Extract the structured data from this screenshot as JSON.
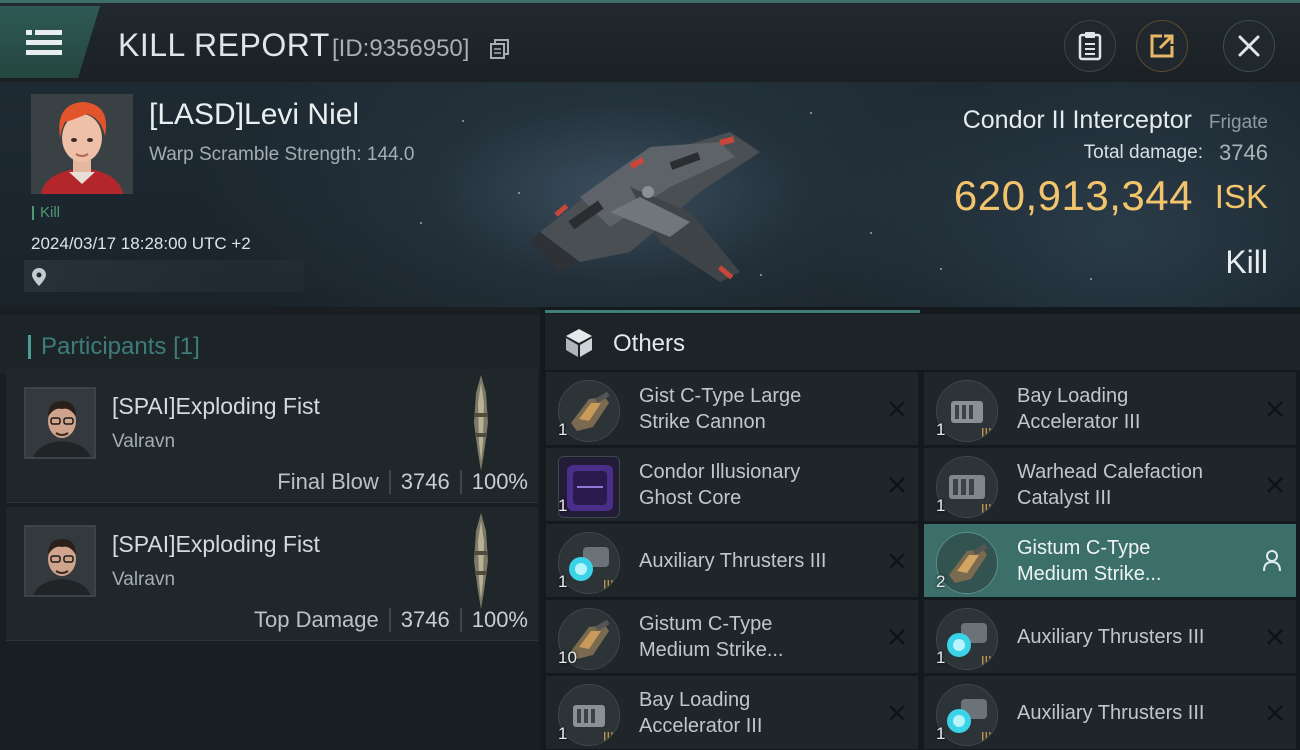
{
  "header": {
    "title": "KILL REPORT",
    "report_id": "[ID:9356950]",
    "icons": [
      "menu-icon",
      "copy-icon",
      "clipboard-icon",
      "share-icon",
      "close-icon"
    ]
  },
  "victim": {
    "name": "[LASD]Levi Niel",
    "warp_scramble": "Warp Scramble Strength: 144.0",
    "result_tag": "Kill",
    "datetime": "2024/03/17 18:28:00 UTC +2",
    "ship_name": "Condor II Interceptor",
    "ship_class": "Frigate",
    "total_damage_label": "Total damage:",
    "total_damage": "3746",
    "isk_value": "620,913,344",
    "isk_label": "ISK",
    "result": "Kill"
  },
  "participants": {
    "title": "Participants",
    "count": "[1]",
    "rows": [
      {
        "name": "[SPAI]Exploding Fist",
        "corp": "Valravn",
        "role": "Final Blow",
        "damage": "3746",
        "percent": "100%"
      },
      {
        "name": "[SPAI]Exploding Fist",
        "corp": "Valravn",
        "role": "Top Damage",
        "damage": "3746",
        "percent": "100%"
      }
    ]
  },
  "others": {
    "title": "Others",
    "items": [
      {
        "name_line1": "Gist C-Type Large",
        "name_line2": "Strike Cannon",
        "qty": "1"
      },
      {
        "name_line1": "Bay Loading",
        "name_line2": "Accelerator III",
        "qty": "1"
      },
      {
        "name_line1": "Condor Illusionary",
        "name_line2": "Ghost Core",
        "qty": "1"
      },
      {
        "name_line1": "Warhead Calefaction",
        "name_line2": "Catalyst III",
        "qty": "1"
      },
      {
        "name_line1": "Auxiliary Thrusters III",
        "qty": "1"
      },
      {
        "name_line1": "Gistum C-Type",
        "name_line2": "Medium Strike...",
        "qty": "2",
        "selected": true
      },
      {
        "name_line1": "Gistum C-Type",
        "name_line2": "Medium Strike...",
        "qty": "10"
      },
      {
        "name_line1": "Auxiliary Thrusters III",
        "qty": "1"
      },
      {
        "name_line1": "Bay Loading",
        "name_line2": "Accelerator III",
        "qty": "1"
      },
      {
        "name_line1": "Auxiliary Thrusters III",
        "qty": "1"
      }
    ]
  },
  "colors": {
    "accent_teal": "#3f7f78",
    "isk_gold": "#f2c46c",
    "kill_green": "#4d9a74",
    "selected_row": "#3c6f6a"
  }
}
